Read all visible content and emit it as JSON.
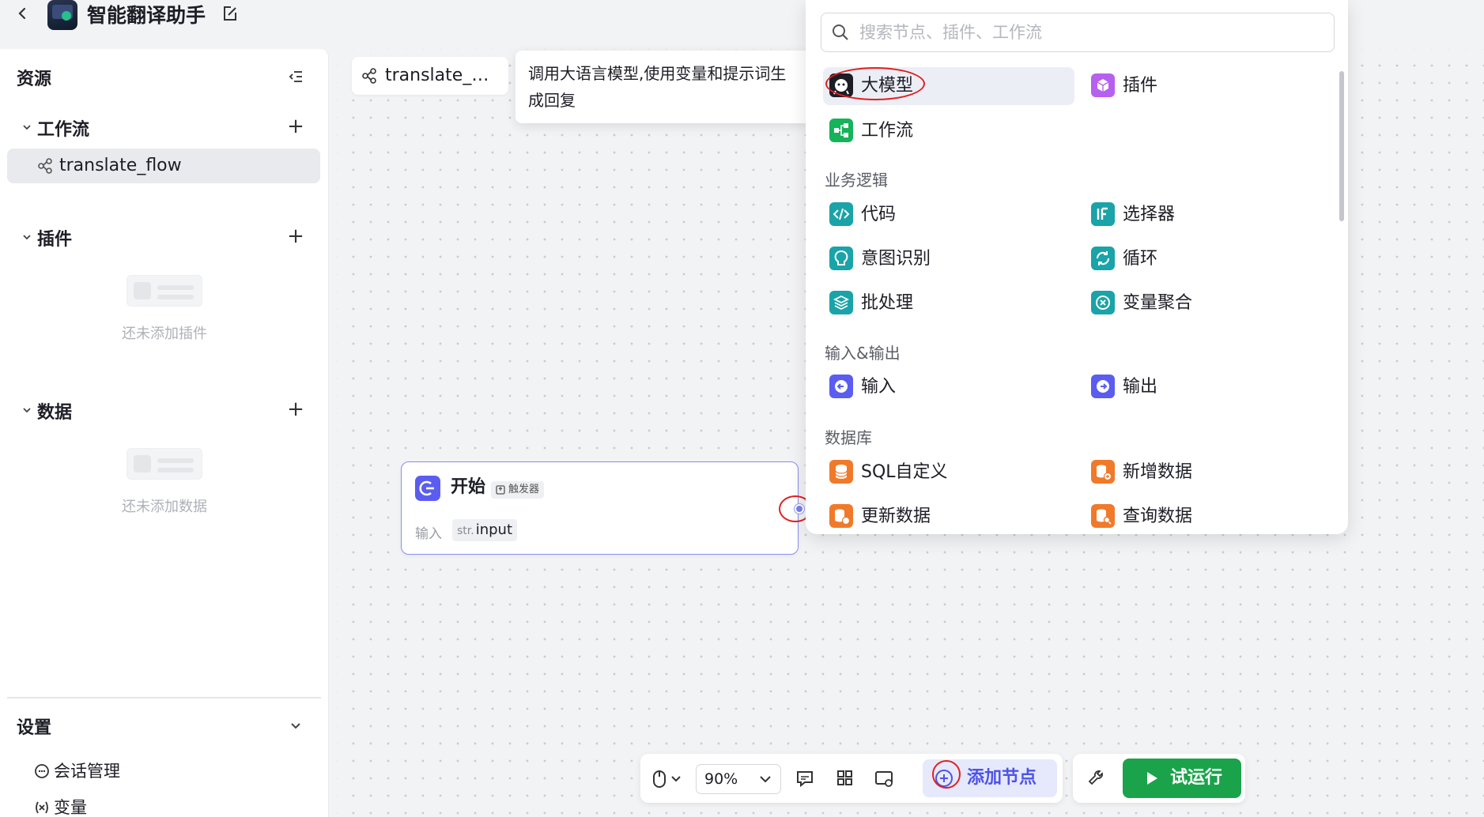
{
  "app": {
    "title": "智能翻译助手"
  },
  "sidebar": {
    "title": "资源",
    "sections": {
      "workflow": {
        "label": "工作流",
        "items": [
          {
            "label": "translate_flow"
          }
        ]
      },
      "plugins": {
        "label": "插件",
        "empty_text": "还未添加插件"
      },
      "data": {
        "label": "数据",
        "empty_text": "还未添加数据"
      }
    },
    "settings": {
      "label": "设置",
      "items": [
        {
          "label": "会话管理"
        },
        {
          "label": "变量"
        }
      ]
    }
  },
  "canvas": {
    "tab_label": "translate_…",
    "tooltip": "调用大语言模型,使用变量和提示词生成回复",
    "start_node": {
      "title": "开始",
      "badge": "触发器",
      "input_label": "输入",
      "input_type": "str.",
      "input_name": "input"
    }
  },
  "node_panel": {
    "search_placeholder": "搜索节点、插件、工作流",
    "top_items": [
      {
        "label": "大模型",
        "icon": "llm-icon"
      },
      {
        "label": "插件",
        "icon": "plugin-icon"
      },
      {
        "label": "工作流",
        "icon": "workflow-icon"
      }
    ],
    "groups": {
      "logic": {
        "label": "业务逻辑",
        "items": [
          {
            "label": "代码"
          },
          {
            "label": "选择器"
          },
          {
            "label": "意图识别"
          },
          {
            "label": "循环"
          },
          {
            "label": "批处理"
          },
          {
            "label": "变量聚合"
          }
        ]
      },
      "io": {
        "label": "输入&输出",
        "items": [
          {
            "label": "输入"
          },
          {
            "label": "输出"
          }
        ]
      },
      "db": {
        "label": "数据库",
        "items": [
          {
            "label": "SQL自定义"
          },
          {
            "label": "新增数据"
          },
          {
            "label": "更新数据"
          },
          {
            "label": "查询数据"
          }
        ]
      }
    }
  },
  "toolbar": {
    "zoom": "90%",
    "add_node": "添加节点",
    "run": "试运行"
  },
  "colors": {
    "accent": "#4d53e8",
    "run": "#1aa34a",
    "highlight_ring": "#e02020"
  }
}
